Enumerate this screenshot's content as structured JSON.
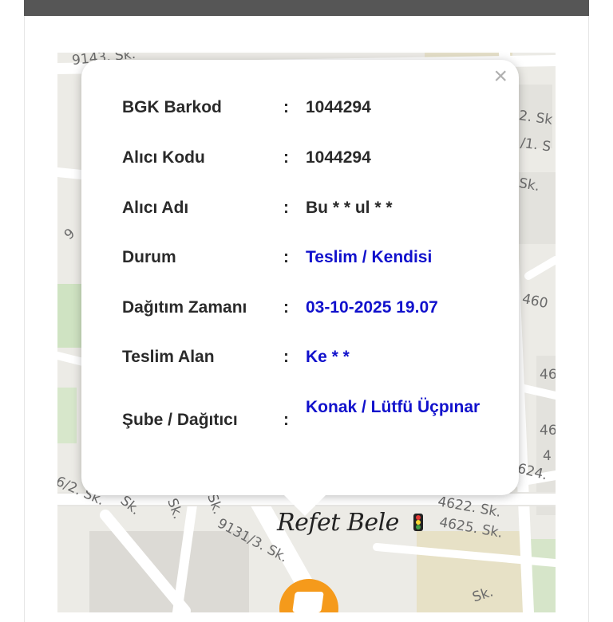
{
  "popup": {
    "close_symbol": "×",
    "rows": [
      {
        "label": "BGK Barkod",
        "sep": ":",
        "value": "1044294",
        "highlight": false
      },
      {
        "label": "Alıcı Kodu",
        "sep": ":",
        "value": "1044294",
        "highlight": false
      },
      {
        "label": "Alıcı Adı",
        "sep": ":",
        "value": "Bu * * ul * *",
        "highlight": false
      },
      {
        "label": "Durum",
        "sep": ":",
        "value": "Teslim / Kendisi",
        "highlight": true
      },
      {
        "label": "Dağıtım Zamanı",
        "sep": ":",
        "value": "03-10-2025 19.07",
        "highlight": true
      },
      {
        "label": "Teslim Alan",
        "sep": ":",
        "value": "Ke * *",
        "highlight": true
      },
      {
        "label": "Şube / Dağıtıcı",
        "sep": ":",
        "value": "Konak / Lütfü Üçpınar",
        "highlight": true
      }
    ]
  },
  "map": {
    "place_name": "Refet Bele",
    "street_labels": [
      "9143. Sk.",
      "2. Sk",
      "/1. S",
      "Sk.",
      "460",
      "46",
      "4",
      "46",
      "624.",
      "6/2. Sk.",
      "Sk.",
      "Sk.",
      "Sk.",
      "4622. Sk.",
      "4625. Sk.",
      "9131/3. Sk.",
      "Sk.",
      "9"
    ],
    "marker_icon": "package-icon",
    "traffic_icon": "traffic-light-icon"
  },
  "colors": {
    "label_text": "#2a2a2a",
    "highlight_text": "#1111cc",
    "marker": "#f59a1b",
    "topbar": "#565656"
  }
}
